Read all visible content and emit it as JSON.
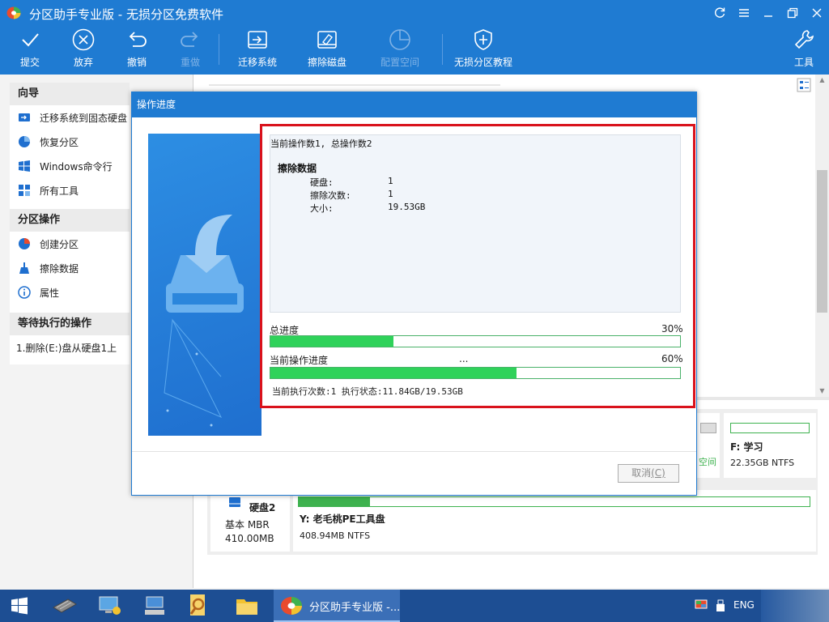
{
  "window": {
    "title": "分区助手专业版 - 无损分区免费软件"
  },
  "toolbar": {
    "commit": "提交",
    "discard": "放弃",
    "undo": "撤销",
    "redo": "重做",
    "migrate_os": "迁移系统",
    "wipe_disk": "擦除磁盘",
    "allocate_space": "配置空间",
    "tutorial": "无损分区教程",
    "tools": "工具"
  },
  "sidebar": {
    "wizard_header": "向导",
    "wizard_items": [
      {
        "label": "迁移系统到固态硬盘",
        "icon": "migrate-icon"
      },
      {
        "label": "恢复分区",
        "icon": "recover-icon"
      },
      {
        "label": "Windows命令行",
        "icon": "windows-icon"
      },
      {
        "label": "所有工具",
        "icon": "tools-grid-icon"
      }
    ],
    "partition_header": "分区操作",
    "partition_items": [
      {
        "label": "创建分区",
        "icon": "create-partition-icon"
      },
      {
        "label": "擦除数据",
        "icon": "wipe-icon"
      },
      {
        "label": "属性",
        "icon": "info-icon"
      }
    ],
    "pending_header": "等待执行的操作",
    "pending_items": [
      "1.删除(E:)盘从硬盘1上"
    ]
  },
  "disk_list": {
    "partial_label": "空间",
    "f_partition": {
      "name": "F: 学习",
      "detail": "22.35GB NTFS"
    },
    "disk2": {
      "name": "硬盘2",
      "type": "基本 MBR",
      "size": "410.00MB",
      "partition_name": "Y: 老毛桃PE工具盘",
      "partition_detail": "408.94MB NTFS",
      "usage_fraction": 0.14
    }
  },
  "dialog": {
    "title": "操作进度",
    "op_count": "当前操作数1, 总操作数2",
    "op_name": "擦除数据",
    "fields": [
      {
        "label": "硬盘:",
        "value": "1"
      },
      {
        "label": "擦除次数:",
        "value": "1"
      },
      {
        "label": "大小:",
        "value": "19.53GB"
      }
    ],
    "total_label": "总进度",
    "total_percent_text": "30%",
    "total_fraction": 0.3,
    "current_label": "当前操作进度",
    "current_ellipsis": "...",
    "current_percent_text": "60%",
    "current_fraction": 0.6,
    "status": "当前执行次数:1 执行状态:11.84GB/19.53GB",
    "cancel_label": "取消",
    "cancel_hotkey": "(C)"
  },
  "taskbar": {
    "active_window": "分区助手专业版 -...",
    "language": "ENG"
  },
  "colors": {
    "brand_blue": "#1f7bd2",
    "progress_green": "#2fd25a",
    "highlight_red": "#d9121c"
  }
}
